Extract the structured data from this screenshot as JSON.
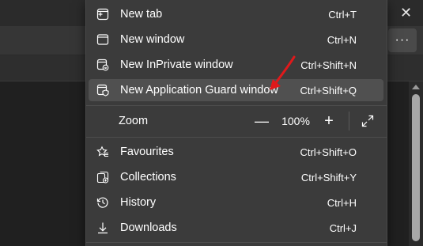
{
  "window": {
    "close_glyph": "✕",
    "more_glyph": "···"
  },
  "menu": {
    "items": [
      {
        "label": "New tab",
        "shortcut": "Ctrl+T",
        "icon": "new-tab-icon"
      },
      {
        "label": "New window",
        "shortcut": "Ctrl+N",
        "icon": "new-window-icon"
      },
      {
        "label": "New InPrivate window",
        "shortcut": "Ctrl+Shift+N",
        "icon": "inprivate-icon"
      },
      {
        "label": "New Application Guard window",
        "shortcut": "Ctrl+Shift+Q",
        "icon": "application-guard-icon"
      }
    ],
    "zoom": {
      "label": "Zoom",
      "minus": "—",
      "value": "100%",
      "plus": "+"
    },
    "items2": [
      {
        "label": "Favourites",
        "shortcut": "Ctrl+Shift+O",
        "icon": "favourites-icon"
      },
      {
        "label": "Collections",
        "shortcut": "Ctrl+Shift+Y",
        "icon": "collections-icon"
      },
      {
        "label": "History",
        "shortcut": "Ctrl+H",
        "icon": "history-icon"
      },
      {
        "label": "Downloads",
        "shortcut": "Ctrl+J",
        "icon": "downloads-icon"
      }
    ]
  },
  "colors": {
    "menu_bg": "#3b3b3b",
    "highlight": "#505050",
    "annotation_arrow": "#e0191b"
  }
}
